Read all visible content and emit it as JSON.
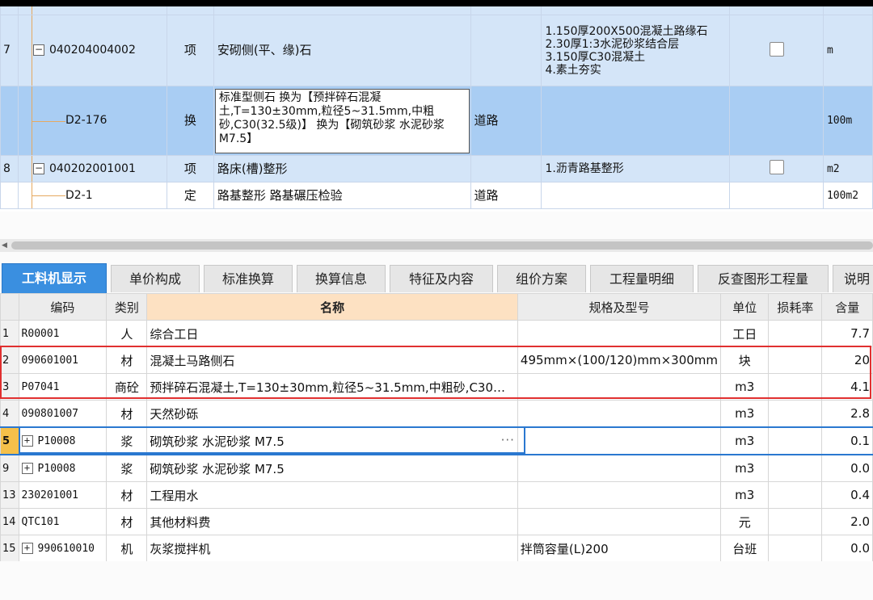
{
  "upper": {
    "rows": [
      {
        "kind": "top",
        "num": "",
        "code": "",
        "cls": "",
        "name": "",
        "desc": "",
        "spec": "",
        "unit": ""
      },
      {
        "kind": "top",
        "num": "7",
        "code": "040204004002",
        "cls": "项",
        "name": "安砌侧(平、缘)石",
        "desc": "",
        "spec": "1.150厚200X500混凝土路缘石\n2.30厚1:3水泥砂浆结合层\n3.150厚C30混凝土\n4.素土夯实",
        "unit": "m",
        "checkbox": true
      },
      {
        "kind": "sel",
        "num": "",
        "code": "D2-176",
        "cls": "换",
        "name": "标准型侧石  换为【预拌碎石混凝土,T=130±30mm,粒径5~31.5mm,中粗砂,C30(32.5级)】  换为【砌筑砂浆 水泥砂浆 M7.5】",
        "desc": "道路",
        "spec": "",
        "unit": "100m"
      },
      {
        "kind": "top",
        "num": "8",
        "code": "040202001001",
        "cls": "项",
        "name": "路床(槽)整形",
        "desc": "",
        "spec": "1.沥青路基整形",
        "unit": "m2",
        "checkbox": true
      },
      {
        "kind": "sub",
        "num": "",
        "code": "D2-1",
        "cls": "定",
        "name": "路基整形 路基碾压检验",
        "desc": "道路",
        "spec": "",
        "unit": "100m2"
      }
    ]
  },
  "tabs": [
    "工料机显示",
    "单价构成",
    "标准换算",
    "换算信息",
    "特征及内容",
    "组价方案",
    "工程量明细",
    "反查图形工程量",
    "说明"
  ],
  "grid": {
    "headers": {
      "code": "编码",
      "type": "类别",
      "name": "名称",
      "spec": "规格及型号",
      "unit": "单位",
      "loss": "损耗率",
      "qty": "含量"
    },
    "rows": [
      {
        "idx": "1",
        "code": "R00001",
        "type": "人",
        "name": "综合工日",
        "spec": "",
        "unit": "工日",
        "loss": "",
        "qty": "7.7"
      },
      {
        "idx": "2",
        "code": "090601001",
        "type": "材",
        "name": "混凝土马路侧石",
        "spec": "495mm×(100/120)mm×300mm",
        "unit": "块",
        "loss": "",
        "qty": "20"
      },
      {
        "idx": "3",
        "code": "P07041",
        "type": "商砼",
        "name": "预拌碎石混凝土,T=130±30mm,粒径5~31.5mm,中粗砂,C30…",
        "spec": "",
        "unit": "m3",
        "loss": "",
        "qty": "4.1"
      },
      {
        "idx": "4",
        "code": "090801007",
        "type": "材",
        "name": "天然砂砾",
        "spec": "",
        "unit": "m3",
        "loss": "",
        "qty": "2.8"
      },
      {
        "idx": "5",
        "code": "P10008",
        "type": "浆",
        "name": "砌筑砂浆 水泥砂浆 M7.5",
        "spec": "",
        "unit": "m3",
        "loss": "",
        "qty": "0.1",
        "plus": true,
        "current": true
      },
      {
        "idx": "9",
        "code": "P10008",
        "type": "浆",
        "name": "砌筑砂浆 水泥砂浆 M7.5",
        "spec": "",
        "unit": "m3",
        "loss": "",
        "qty": "0.0",
        "plus": true
      },
      {
        "idx": "13",
        "code": "230201001",
        "type": "材",
        "name": "工程用水",
        "spec": "",
        "unit": "m3",
        "loss": "",
        "qty": "0.4"
      },
      {
        "idx": "14",
        "code": "QTC101",
        "type": "材",
        "name": "其他材料费",
        "spec": "",
        "unit": "元",
        "loss": "",
        "qty": "2.0"
      },
      {
        "idx": "15",
        "code": "990610010",
        "type": "机",
        "name": "灰浆搅拌机",
        "spec": "拌筒容量(L)200",
        "unit": "台班",
        "loss": "",
        "qty": "0.0",
        "plus": true
      }
    ]
  }
}
